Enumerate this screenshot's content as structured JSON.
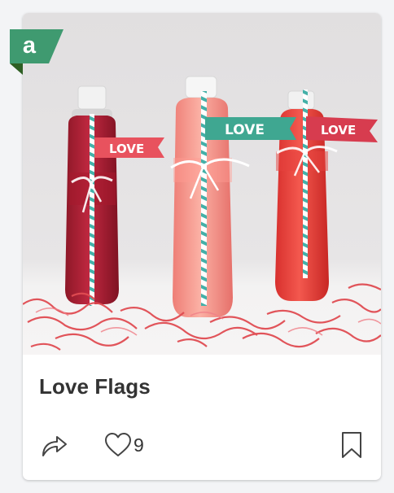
{
  "card": {
    "title": "Love Flags",
    "like_count": "9"
  },
  "photo": {
    "flag_text_left": "LOVE",
    "flag_text_middle": "LOVE",
    "flag_text_right": "LOVE"
  },
  "badge": {
    "letter": "a",
    "color": "#3f9a70",
    "fold_color": "#2e5f24"
  },
  "icons": {
    "share": "share-arrow-icon",
    "like": "heart-icon",
    "bookmark": "bookmark-icon"
  }
}
